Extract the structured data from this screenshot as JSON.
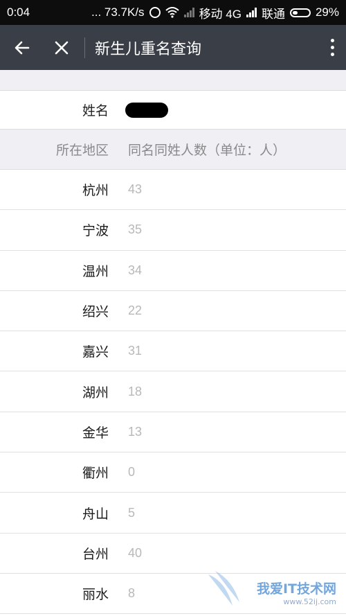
{
  "status_bar": {
    "time": "0:04",
    "speed": "... 73.7K/s",
    "carrier1": "移动 4G",
    "carrier2": "联通",
    "battery": "29%"
  },
  "app_bar": {
    "title": "新生儿重名查询"
  },
  "name_row": {
    "label": "姓名"
  },
  "table": {
    "headers": [
      "所在地区",
      "同名同姓人数（单位：人）"
    ],
    "rows": [
      {
        "city": "杭州",
        "count": "43"
      },
      {
        "city": "宁波",
        "count": "35"
      },
      {
        "city": "温州",
        "count": "34"
      },
      {
        "city": "绍兴",
        "count": "22"
      },
      {
        "city": "嘉兴",
        "count": "31"
      },
      {
        "city": "湖州",
        "count": "18"
      },
      {
        "city": "金华",
        "count": "13"
      },
      {
        "city": "衢州",
        "count": "0"
      },
      {
        "city": "舟山",
        "count": "5"
      },
      {
        "city": "台州",
        "count": "40"
      },
      {
        "city": "丽水",
        "count": "8"
      }
    ]
  },
  "watermark": {
    "text": "我爱IT技术网",
    "sub": "www.52ij.com"
  },
  "colors": {
    "app_bar_bg": "#3a3f47",
    "status_bar_bg": "#0d0d0d",
    "section_bg": "#efeff4"
  }
}
